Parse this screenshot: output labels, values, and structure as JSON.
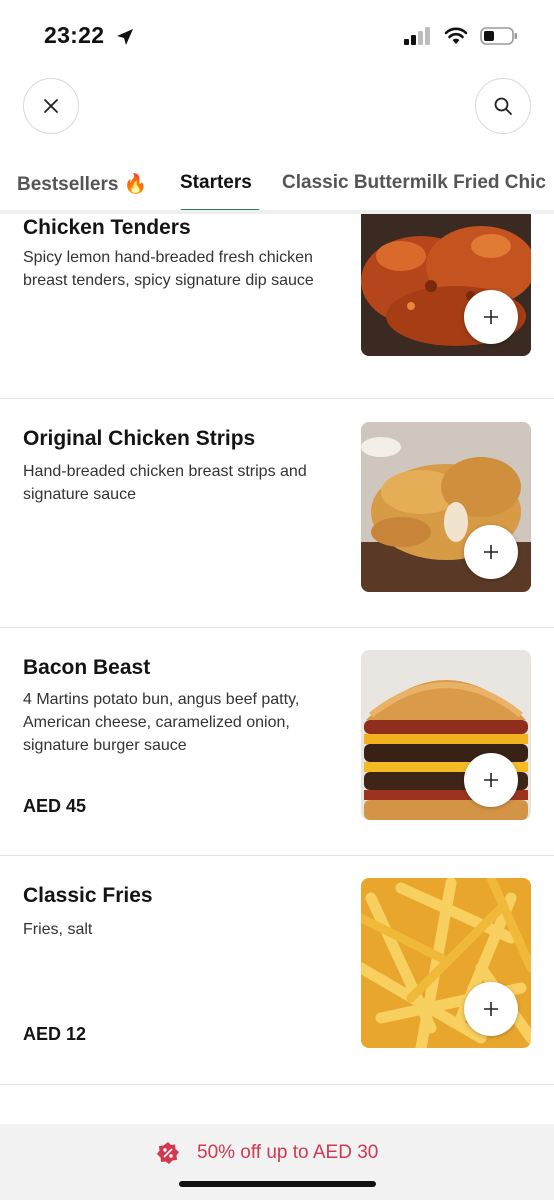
{
  "status": {
    "time": "23:22"
  },
  "header": {
    "close_icon": "close-icon",
    "search_icon": "search-icon"
  },
  "tabs": [
    {
      "label": "Bestsellers",
      "emoji": "🔥"
    },
    {
      "label": "Starters"
    },
    {
      "label": "Classic Buttermilk Fried Chic"
    }
  ],
  "items": [
    {
      "title": "Chicken Tenders",
      "desc": "Spicy lemon hand-breaded fresh chicken breast tenders, spicy signature dip sauce",
      "price": ""
    },
    {
      "title": "Original Chicken Strips",
      "desc": "Hand-breaded chicken breast strips and signature sauce",
      "price": ""
    },
    {
      "title": "Bacon Beast",
      "desc": "4 Martins potato bun, angus beef patty, American cheese, caramelized onion, signature burger sauce",
      "price": "AED 45"
    },
    {
      "title": "Classic Fries",
      "desc": "Fries, salt",
      "price": "AED 12"
    }
  ],
  "promo": {
    "text": "50% off up to AED 30",
    "icon": "discount-badge-icon"
  },
  "colors": {
    "accent": "#2b7a5f",
    "promo": "#d0394f"
  }
}
